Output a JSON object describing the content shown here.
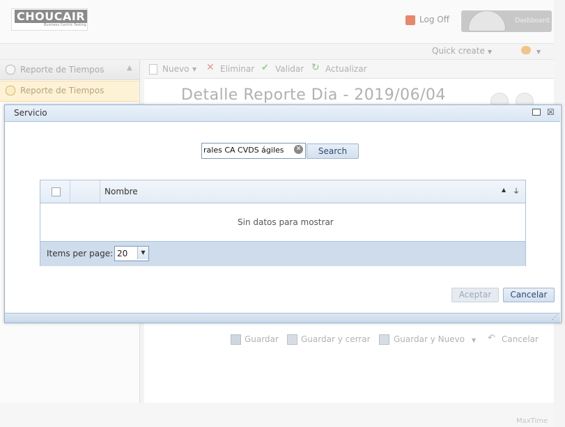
{
  "header": {
    "brand": "CHOUCAIR",
    "brand_sub": "Business Centric Testing",
    "logoff_label": "Log Off",
    "dashboard_label": "Dashboard",
    "quick_create_label": "Quick create"
  },
  "left_panel": {
    "header_label": "Reporte de Tiempos",
    "items": [
      {
        "label": "Reporte de Tiempos"
      }
    ]
  },
  "toolbar": {
    "nuevo": "Nuevo",
    "eliminar": "Eliminar",
    "validar": "Validar",
    "actualizar": "Actualizar"
  },
  "main": {
    "title": "Detalle Reporte Dia - 2019/06/04"
  },
  "form_actions": {
    "guardar": "Guardar",
    "guardar_cerrar": "Guardar y cerrar",
    "guardar_nuevo": "Guardar y Nuevo",
    "cancelar": "Cancelar"
  },
  "footer": {
    "brand": "MaxTime"
  },
  "dialog": {
    "title": "Servicio",
    "search": {
      "value": "rales CA CVDS ágiles",
      "button": "Search"
    },
    "grid": {
      "columns": [
        "Nombre"
      ],
      "empty_text": "Sin datos para mostrar",
      "pager_label": "Items per page:",
      "page_size": "20"
    },
    "buttons": {
      "accept": "Aceptar",
      "cancel": "Cancelar"
    }
  },
  "colors": {
    "dialog_header": "#d9e6f4",
    "grid_pager": "#cfdcec",
    "selected_item": "#fdf2d6"
  },
  "icons": [
    "logoff-icon",
    "dashboard-gauge-icon",
    "help-icon",
    "clock-icon",
    "new-icon",
    "delete-icon",
    "check-icon",
    "refresh-icon",
    "save-icon",
    "save-close-icon",
    "save-new-icon",
    "undo-icon",
    "maximize-icon",
    "close-icon",
    "clear-icon",
    "sort-icon",
    "filter-icon"
  ]
}
